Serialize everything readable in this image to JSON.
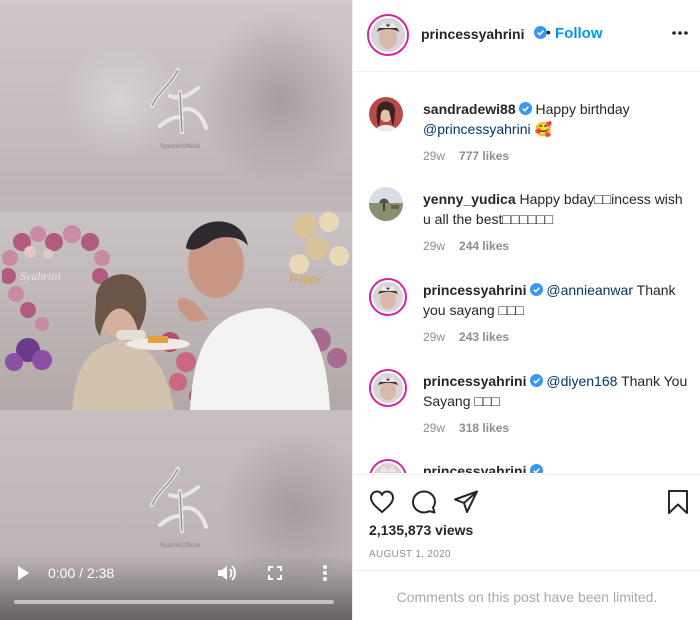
{
  "video": {
    "time_display": "0:00 / 2:38",
    "progress_fraction": 0.0,
    "watermark_text": "SyahriniOfficial",
    "frame_sign_text": "Syahrini"
  },
  "post": {
    "author": "princessyahrini",
    "follow_label": "Follow",
    "follow_separator": "•",
    "views": "2,135,873 views",
    "date": "AUGUST 1, 2020",
    "comments_limited": "Comments on this post have been limited."
  },
  "comments": [
    {
      "username": "sandradewi88",
      "verified": true,
      "text": "Happy birthday",
      "mention": "@princessyahrini",
      "trailing": " 🥰",
      "time": "29w",
      "likes": "777 likes"
    },
    {
      "username": "yenny_yudica",
      "verified": false,
      "text": "Happy bday□□incess wish u all the best□□□□□□",
      "mention": "",
      "trailing": "",
      "time": "29w",
      "likes": "244 likes"
    },
    {
      "username": "princessyahrini",
      "verified": true,
      "text": "Thank you sayang □□□",
      "mention": "@annieanwar",
      "trailing": "",
      "time": "29w",
      "likes": "243 likes"
    },
    {
      "username": "princessyahrini",
      "verified": true,
      "text": "Thank You Sayang □□□",
      "mention": "@diyen168",
      "trailing": "",
      "time": "29w",
      "likes": "318 likes"
    },
    {
      "username": "princessyahrini",
      "verified": true,
      "text": "",
      "mention": "",
      "trailing": "",
      "time": "",
      "likes": ""
    }
  ],
  "icons": {
    "like": "heart-icon",
    "comment": "comment-bubble-icon",
    "share": "paper-plane-icon",
    "save": "bookmark-icon",
    "verified": "verified-badge-icon",
    "more": "ellipsis-icon"
  },
  "colors": {
    "link_blue": "#0095f6",
    "mention_blue": "#00376b",
    "verified_blue": "#3897f0",
    "meta_gray": "#8e8e8e"
  }
}
